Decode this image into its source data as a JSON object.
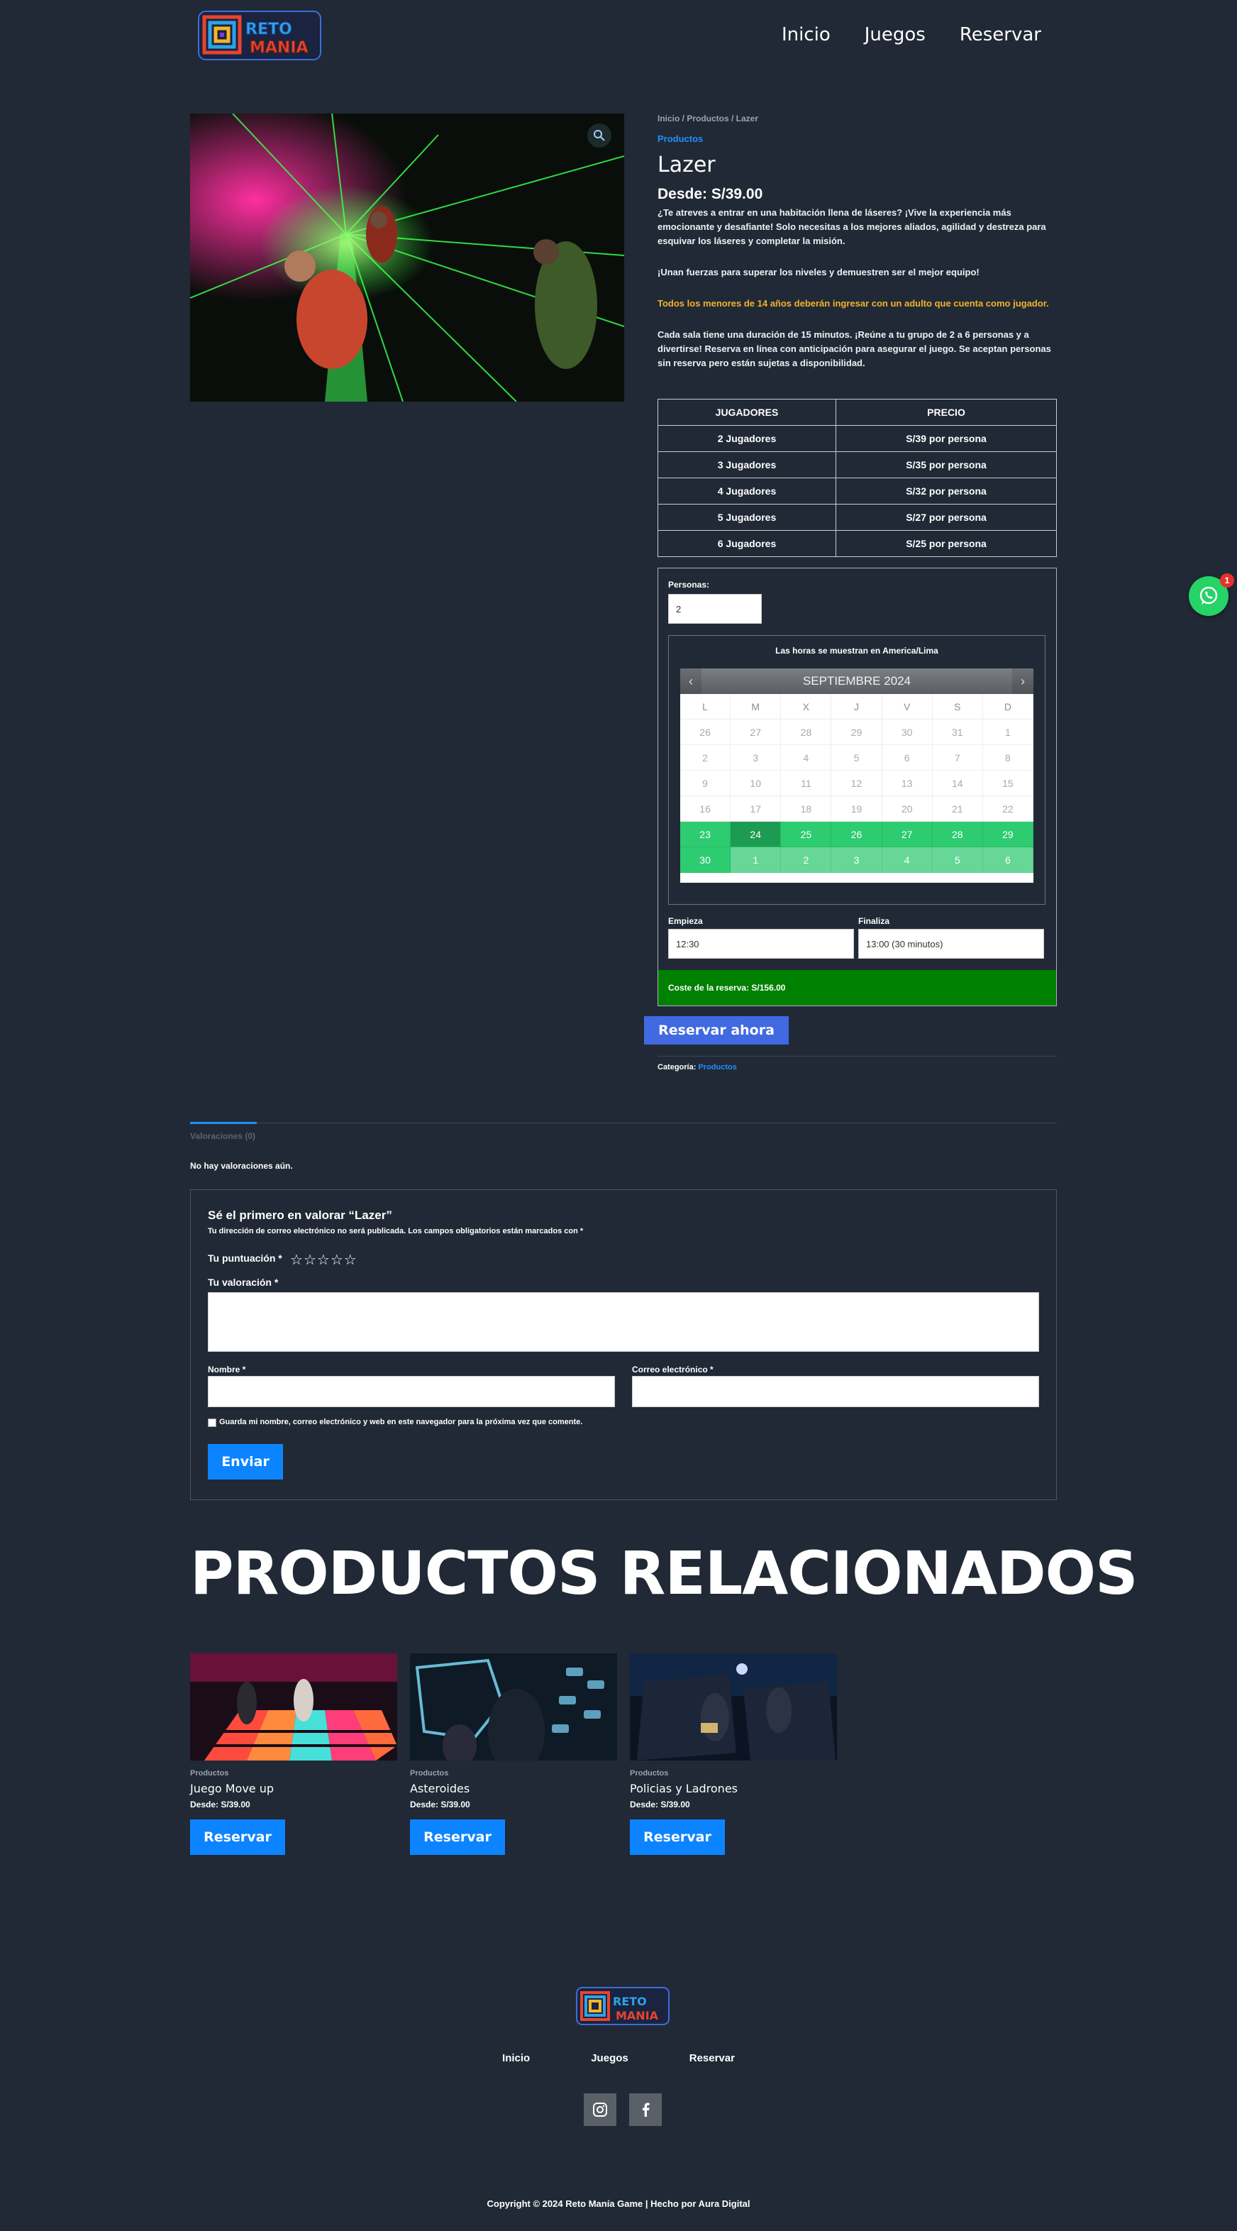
{
  "brand": {
    "logo_line1": "RETO",
    "logo_line2": "MANIA"
  },
  "nav": [
    "Inicio",
    "Juegos",
    "Reservar"
  ],
  "breadcrumb": "Inicio / Productos / Lazer",
  "category_link": "Productos",
  "product": {
    "title": "Lazer",
    "price": "Desde: S/39.00",
    "desc1": "¿Te atreves a entrar en una habitación llena de láseres? ¡Vive la experiencia más emocionante y desafiante! Solo necesitas a los mejores aliados, agilidad y destreza para esquivar los láseres y completar la misión.",
    "desc2": "¡Unan fuerzas para superar los niveles y demuestren ser el mejor equipo!",
    "warning": "Todos los menores de 14 años deberán ingresar con un adulto que cuenta como jugador.",
    "desc3": "Cada sala tiene una duración de 15 minutos. ¡Reúne a tu grupo de 2 a 6 personas y a divertirse! Reserva en línea con anticipación para asegurar el juego. Se aceptan personas sin reserva pero están sujetas a disponibilidad."
  },
  "price_table": {
    "headers": [
      "JUGADORES",
      "PRECIO"
    ],
    "rows": [
      [
        "2 Jugadores",
        "S/39 por persona"
      ],
      [
        "3 Jugadores",
        "S/35 por persona"
      ],
      [
        "4 Jugadores",
        "S/32 por persona"
      ],
      [
        "5 Jugadores",
        "S/27 por persona"
      ],
      [
        "6 Jugadores",
        "S/25 por persona"
      ]
    ]
  },
  "booking": {
    "persons_label": "Personas:",
    "persons_value": "2",
    "timezone_note": "Las horas se muestran en America/Lima",
    "month": "SEPTIEMBRE 2024",
    "weekdays": [
      "L",
      "M",
      "X",
      "J",
      "V",
      "S",
      "D"
    ],
    "weeks": [
      [
        "26",
        "27",
        "28",
        "29",
        "30",
        "31",
        "1"
      ],
      [
        "2",
        "3",
        "4",
        "5",
        "6",
        "7",
        "8"
      ],
      [
        "9",
        "10",
        "11",
        "12",
        "13",
        "14",
        "15"
      ],
      [
        "16",
        "17",
        "18",
        "19",
        "20",
        "21",
        "22"
      ],
      [
        "23",
        "24",
        "25",
        "26",
        "27",
        "28",
        "29"
      ],
      [
        "30",
        "1",
        "2",
        "3",
        "4",
        "5",
        "6"
      ]
    ],
    "start_label": "Empieza",
    "start_value": "12:30",
    "end_label": "Finaliza",
    "end_value": "13:00 (30 minutos)",
    "cost": "Coste de la reserva: S/156.00",
    "book_button": "Reservar ahora"
  },
  "meta": {
    "category_label": "Categoría:",
    "category": "Productos"
  },
  "reviews": {
    "tab": "Valoraciones (0)",
    "none": "No hay valoraciones aún.",
    "form_title": "Sé el primero en valorar “Lazer”",
    "note": "Tu dirección de correo electrónico no será publicada. Los campos obligatorios están marcados con *",
    "rating_label": "Tu puntuación *",
    "review_label": "Tu valoración *",
    "name_label": "Nombre *",
    "email_label": "Correo electrónico *",
    "save_label": "Guarda mi nombre, correo electrónico y web en este navegador para la próxima vez que comente.",
    "submit": "Enviar"
  },
  "related": {
    "title": "PRODUCTOS RELACIONADOS",
    "items": [
      {
        "category": "Productos",
        "name": "Juego Move up",
        "price": "Desde: S/39.00",
        "button": "Reservar"
      },
      {
        "category": "Productos",
        "name": "Asteroides",
        "price": "Desde: S/39.00",
        "button": "Reservar"
      },
      {
        "category": "Productos",
        "name": "Policias y Ladrones",
        "price": "Desde: S/39.00",
        "button": "Reservar"
      }
    ]
  },
  "whatsapp_badge": "1",
  "footer": {
    "nav": [
      "Inicio",
      "Juegos",
      "Reservar"
    ],
    "copyright": "Copyright © 2024 Reto Manía Game | Hecho por Aura Digital"
  },
  "colors": {
    "bg": "#212936",
    "accent": "#1e90ff",
    "book": "#4169e1",
    "cost": "#008000",
    "available": "#2ecc71"
  }
}
